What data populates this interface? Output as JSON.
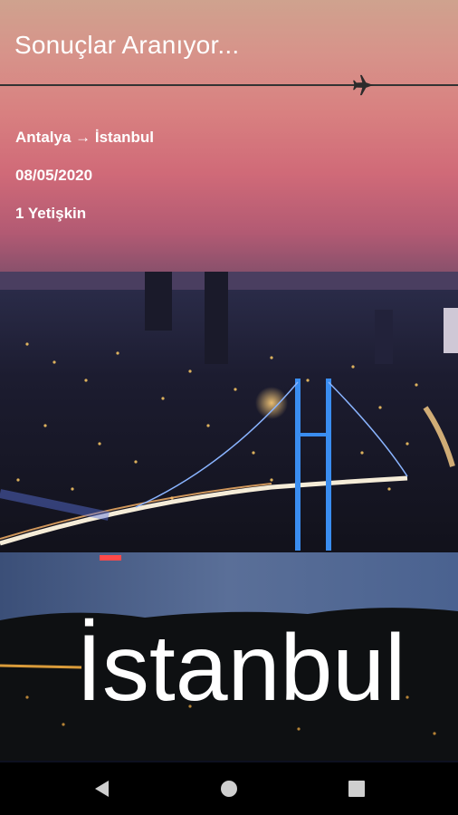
{
  "header": {
    "title": "Sonuçlar Aranıyor..."
  },
  "search": {
    "route": "Antalya → İstanbul",
    "date": "08/05/2020",
    "passengers": "1 Yetişkin"
  },
  "destination": {
    "city": "İstanbul"
  },
  "icons": {
    "plane": "airplane-icon",
    "back": "back-triangle-icon",
    "home": "home-circle-icon",
    "recent": "recent-square-icon"
  },
  "colors": {
    "text": "#ffffff",
    "line": "#333333",
    "navbar": "#000000"
  }
}
